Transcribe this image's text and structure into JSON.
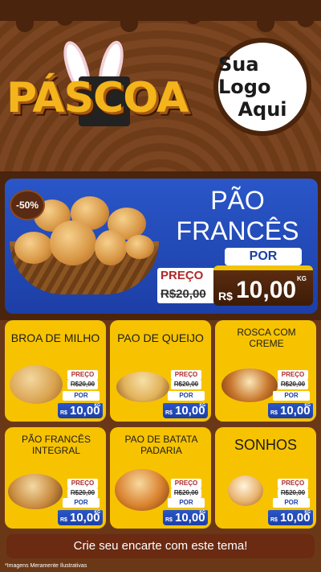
{
  "header": {
    "title": "PÁSCOA",
    "logo_line1": "Sua Logo",
    "logo_line2": "Aqui"
  },
  "hero": {
    "discount": "-50%",
    "title_line1": "PÃO",
    "title_line2": "FRANCÊS",
    "preco_label": "PREÇO",
    "old_price": "R$20,00",
    "por_label": "POR",
    "currency": "R$",
    "new_price": "10,00",
    "unit": "KG"
  },
  "products": [
    {
      "name": "BROA DE MILHO",
      "preco": "PREÇO",
      "old": "R$20,00",
      "por": "POR",
      "currency": "R$",
      "price": "10,00",
      "unit": "KG"
    },
    {
      "name": "PAO DE QUEIJO",
      "preco": "PREÇO",
      "old": "R$20,00",
      "por": "POR",
      "currency": "R$",
      "price": "10,00",
      "unit": "KG"
    },
    {
      "name": "ROSCA COM CREME",
      "preco": "PREÇO",
      "old": "R$20,00",
      "por": "POR",
      "currency": "R$",
      "price": "10,00",
      "unit": "KG"
    },
    {
      "name": "PÃO FRANCÊS INTEGRAL",
      "preco": "PREÇO",
      "old": "R$20,00",
      "por": "POR",
      "currency": "R$",
      "price": "10,00",
      "unit": "KG"
    },
    {
      "name": "PAO DE BATATA PADARIA",
      "preco": "PREÇO",
      "old": "R$20,00",
      "por": "POR",
      "currency": "R$",
      "price": "10,00",
      "unit": "KG"
    },
    {
      "name": "SONHOS",
      "preco": "PREÇO",
      "old": "R$20,00",
      "por": "POR",
      "currency": "R$",
      "price": "10,00",
      "unit": "KG"
    }
  ],
  "footer": {
    "cta": "Crie seu encarte com este tema!",
    "disclaimer": "*Imagens Meramente Ilustrativas"
  },
  "colors": {
    "background": "#6b3817",
    "card": "#f7c300",
    "blue": "#1c3fa6",
    "brand_yellow": "#f4b41c"
  }
}
